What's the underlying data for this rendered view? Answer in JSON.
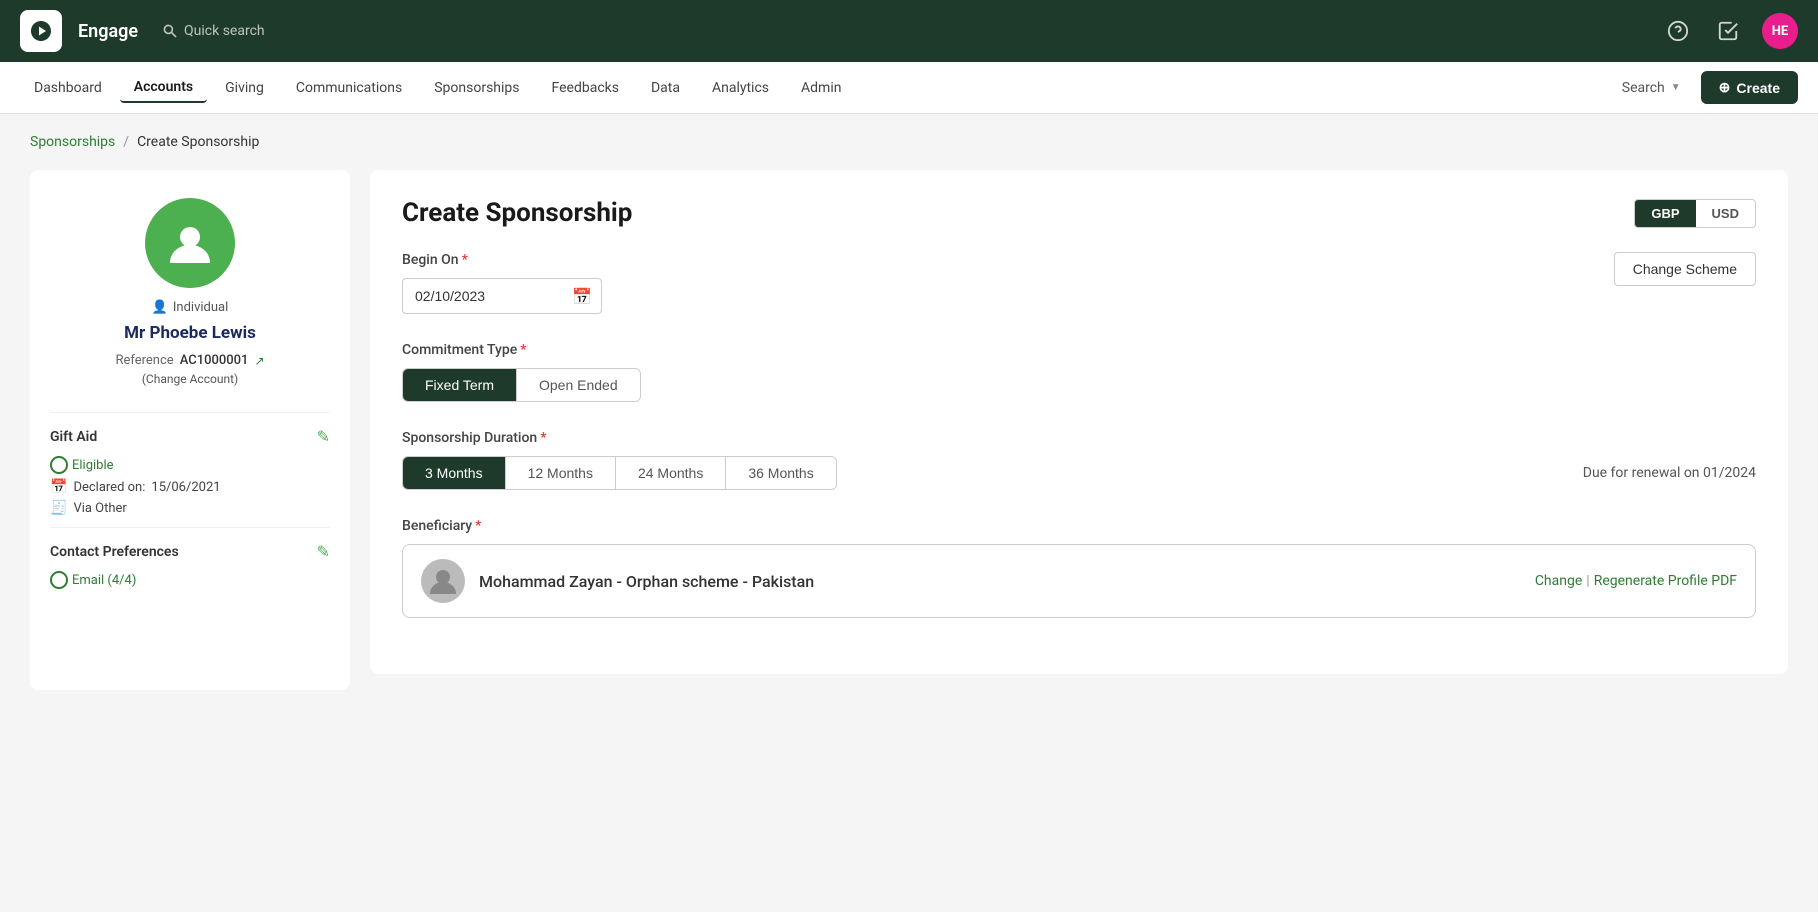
{
  "app": {
    "name": "Engage",
    "search_placeholder": "Quick search"
  },
  "topbar": {
    "avatar_initials": "HE"
  },
  "navmenu": {
    "items": [
      {
        "label": "Dashboard",
        "active": false
      },
      {
        "label": "Accounts",
        "active": true
      },
      {
        "label": "Giving",
        "active": false
      },
      {
        "label": "Communications",
        "active": false
      },
      {
        "label": "Sponsorships",
        "active": false
      },
      {
        "label": "Feedbacks",
        "active": false
      },
      {
        "label": "Data",
        "active": false
      },
      {
        "label": "Analytics",
        "active": false
      },
      {
        "label": "Admin",
        "active": false
      }
    ],
    "search_label": "Search",
    "create_label": "Create"
  },
  "breadcrumb": {
    "parent": "Sponsorships",
    "current": "Create Sponsorship"
  },
  "sidebar": {
    "person_type": "Individual",
    "name": "Mr Phoebe Lewis",
    "ref_label": "Reference",
    "ref_value": "AC1000001",
    "change_account": "(Change Account)",
    "gift_aid_title": "Gift Aid",
    "gift_aid_status": "Eligible",
    "declared_label": "Declared on:",
    "declared_date": "15/06/2021",
    "via_label": "Via Other",
    "contact_prefs_title": "Contact Preferences",
    "contact_email": "Email (4/4)"
  },
  "form": {
    "title": "Create Sponsorship",
    "currency_gbp": "GBP",
    "currency_usd": "USD",
    "currency_active": "gbp",
    "change_scheme_label": "Change Scheme",
    "begin_on_label": "Begin On",
    "begin_on_required": true,
    "begin_on_value": "02/10/2023",
    "commitment_type_label": "Commitment Type",
    "commitment_type_required": true,
    "commitment_types": [
      {
        "label": "Fixed Term",
        "active": true
      },
      {
        "label": "Open Ended",
        "active": false
      }
    ],
    "duration_label": "Sponsorship Duration",
    "duration_required": true,
    "duration_options": [
      {
        "label": "3 Months",
        "active": true
      },
      {
        "label": "12 Months",
        "active": false
      },
      {
        "label": "24 Months",
        "active": false
      },
      {
        "label": "36 Months",
        "active": false
      }
    ],
    "renewal_note": "Due for renewal on 01/2024",
    "beneficiary_label": "Beneficiary",
    "beneficiary_required": true,
    "beneficiary_name": "Mohammad Zayan - Orphan scheme - Pakistan",
    "beneficiary_change": "Change",
    "beneficiary_sep": "|",
    "beneficiary_pdf": "Regenerate Profile PDF"
  }
}
